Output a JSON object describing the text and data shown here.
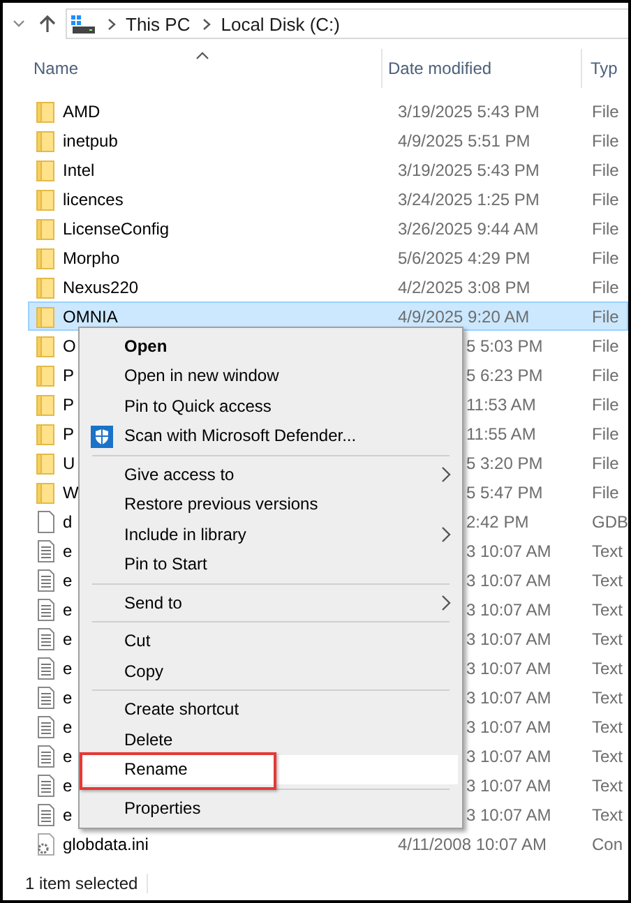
{
  "address_bar": {
    "breadcrumbs": [
      "This PC",
      "Local Disk (C:)"
    ]
  },
  "columns": [
    {
      "label": "Name",
      "sorted": true
    },
    {
      "label": "Date modified",
      "sorted": false
    },
    {
      "label": "Typ",
      "sorted": false
    }
  ],
  "files": [
    {
      "kind": "folder",
      "name": "AMD",
      "date": "3/19/2025 5:43 PM",
      "type": "File",
      "selected": false,
      "covered": false
    },
    {
      "kind": "folder",
      "name": "inetpub",
      "date": "4/9/2025 5:51 PM",
      "type": "File",
      "selected": false,
      "covered": false
    },
    {
      "kind": "folder",
      "name": "Intel",
      "date": "3/19/2025 5:43 PM",
      "type": "File",
      "selected": false,
      "covered": false
    },
    {
      "kind": "folder",
      "name": "licences",
      "date": "3/24/2025 1:25 PM",
      "type": "File",
      "selected": false,
      "covered": false
    },
    {
      "kind": "folder",
      "name": "LicenseConfig",
      "date": "3/26/2025 9:44 AM",
      "type": "File",
      "selected": false,
      "covered": false
    },
    {
      "kind": "folder",
      "name": "Morpho",
      "date": "5/6/2025 4:29 PM",
      "type": "File",
      "selected": false,
      "covered": false
    },
    {
      "kind": "folder",
      "name": "Nexus220",
      "date": "4/2/2025 3:08 PM",
      "type": "File",
      "selected": false,
      "covered": false
    },
    {
      "kind": "folder",
      "name": "OMNIA",
      "date": "4/9/2025 9:20 AM",
      "type": "File",
      "selected": true,
      "covered": false
    },
    {
      "kind": "folder",
      "name": "O",
      "date": "5 5:03 PM",
      "type": "File",
      "selected": false,
      "covered": true
    },
    {
      "kind": "folder",
      "name": "P",
      "date": "5 6:23 PM",
      "type": "File",
      "selected": false,
      "covered": true
    },
    {
      "kind": "folder",
      "name": "P",
      "date": "11:53 AM",
      "type": "File",
      "selected": false,
      "covered": true
    },
    {
      "kind": "folder",
      "name": "P",
      "date": "11:55 AM",
      "type": "File",
      "selected": false,
      "covered": true
    },
    {
      "kind": "folder",
      "name": "U",
      "date": "5 3:20 PM",
      "type": "File",
      "selected": false,
      "covered": true
    },
    {
      "kind": "folder",
      "name": "W",
      "date": "5 5:47 PM",
      "type": "File",
      "selected": false,
      "covered": true
    },
    {
      "kind": "blank",
      "name": "d",
      "date": "2:42 PM",
      "type": "GDB",
      "selected": false,
      "covered": true
    },
    {
      "kind": "text",
      "name": "e",
      "date": "3 10:07 AM",
      "type": "Text",
      "selected": false,
      "covered": true
    },
    {
      "kind": "text",
      "name": "e",
      "date": "3 10:07 AM",
      "type": "Text",
      "selected": false,
      "covered": true
    },
    {
      "kind": "text",
      "name": "e",
      "date": "3 10:07 AM",
      "type": "Text",
      "selected": false,
      "covered": true
    },
    {
      "kind": "text",
      "name": "e",
      "date": "3 10:07 AM",
      "type": "Text",
      "selected": false,
      "covered": true
    },
    {
      "kind": "text",
      "name": "e",
      "date": "3 10:07 AM",
      "type": "Text",
      "selected": false,
      "covered": true
    },
    {
      "kind": "text",
      "name": "e",
      "date": "3 10:07 AM",
      "type": "Text",
      "selected": false,
      "covered": true
    },
    {
      "kind": "text",
      "name": "e",
      "date": "3 10:07 AM",
      "type": "Text",
      "selected": false,
      "covered": true
    },
    {
      "kind": "text",
      "name": "e",
      "date": "3 10:07 AM",
      "type": "Text",
      "selected": false,
      "covered": true
    },
    {
      "kind": "text",
      "name": "e",
      "date": "3 10:07 AM",
      "type": "Text",
      "selected": false,
      "covered": true
    },
    {
      "kind": "text",
      "name": "e",
      "date": "3 10:07 AM",
      "type": "Text",
      "selected": false,
      "covered": true
    },
    {
      "kind": "settings",
      "name": "globdata.ini",
      "date": "4/11/2008 10:07 AM",
      "type": "Con",
      "selected": false,
      "covered": false
    }
  ],
  "context_menu": {
    "items": [
      {
        "kind": "item",
        "label": "Open",
        "default": true,
        "has_icon": false,
        "submenu": false,
        "hovered": false,
        "annotated": false
      },
      {
        "kind": "item",
        "label": "Open in new window",
        "default": false,
        "has_icon": false,
        "submenu": false,
        "hovered": false,
        "annotated": false
      },
      {
        "kind": "item",
        "label": "Pin to Quick access",
        "default": false,
        "has_icon": false,
        "submenu": false,
        "hovered": false,
        "annotated": false
      },
      {
        "kind": "item",
        "label": "Scan with Microsoft Defender...",
        "default": false,
        "has_icon": true,
        "submenu": false,
        "hovered": false,
        "annotated": false
      },
      {
        "kind": "separator"
      },
      {
        "kind": "item",
        "label": "Give access to",
        "default": false,
        "has_icon": false,
        "submenu": true,
        "hovered": false,
        "annotated": false
      },
      {
        "kind": "item",
        "label": "Restore previous versions",
        "default": false,
        "has_icon": false,
        "submenu": false,
        "hovered": false,
        "annotated": false
      },
      {
        "kind": "item",
        "label": "Include in library",
        "default": false,
        "has_icon": false,
        "submenu": true,
        "hovered": false,
        "annotated": false
      },
      {
        "kind": "item",
        "label": "Pin to Start",
        "default": false,
        "has_icon": false,
        "submenu": false,
        "hovered": false,
        "annotated": false
      },
      {
        "kind": "separator"
      },
      {
        "kind": "item",
        "label": "Send to",
        "default": false,
        "has_icon": false,
        "submenu": true,
        "hovered": false,
        "annotated": false
      },
      {
        "kind": "separator"
      },
      {
        "kind": "item",
        "label": "Cut",
        "default": false,
        "has_icon": false,
        "submenu": false,
        "hovered": false,
        "annotated": false
      },
      {
        "kind": "item",
        "label": "Copy",
        "default": false,
        "has_icon": false,
        "submenu": false,
        "hovered": false,
        "annotated": false
      },
      {
        "kind": "separator"
      },
      {
        "kind": "item",
        "label": "Create shortcut",
        "default": false,
        "has_icon": false,
        "submenu": false,
        "hovered": false,
        "annotated": false
      },
      {
        "kind": "item",
        "label": "Delete",
        "default": false,
        "has_icon": false,
        "submenu": false,
        "hovered": false,
        "annotated": false
      },
      {
        "kind": "item",
        "label": "Rename",
        "default": false,
        "has_icon": false,
        "submenu": false,
        "hovered": true,
        "annotated": true
      },
      {
        "kind": "separator"
      },
      {
        "kind": "item",
        "label": "Properties",
        "default": false,
        "has_icon": false,
        "submenu": false,
        "hovered": false,
        "annotated": false
      }
    ]
  },
  "status_bar": {
    "text": "1 item selected"
  }
}
